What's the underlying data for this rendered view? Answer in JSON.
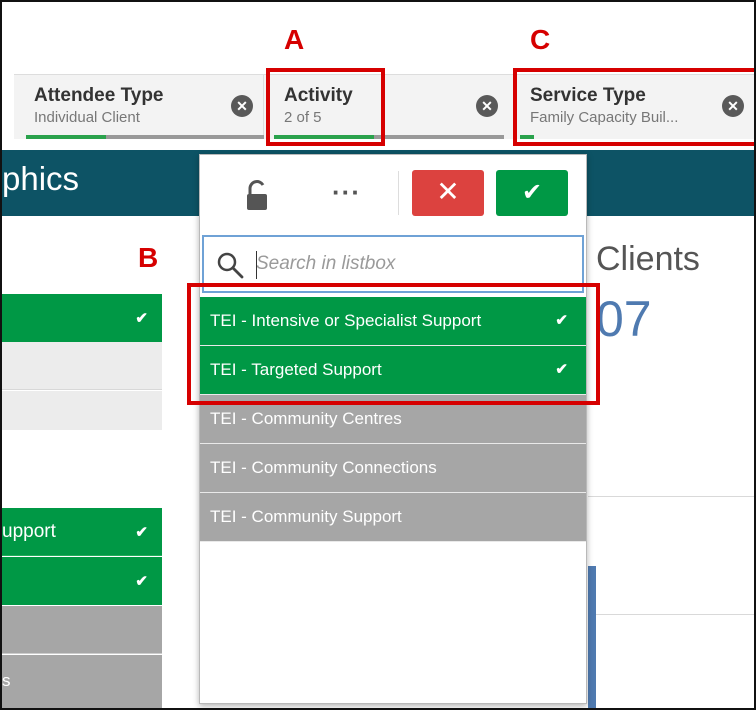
{
  "annotations": {
    "a": "A",
    "b": "B",
    "c": "C"
  },
  "selections": [
    {
      "title": "Attendee Type",
      "subtitle": "Individual Client"
    },
    {
      "title": "Activity",
      "subtitle": "2 of 5"
    },
    {
      "title": "Service Type",
      "subtitle": "Family Capacity Buil..."
    }
  ],
  "icons": {
    "clear": "clear-selection-icon",
    "lock": "unlock-icon",
    "more": "more-options-icon",
    "cancel": "close-icon",
    "confirm": "check-icon",
    "search": "search-icon",
    "check": "check-icon"
  },
  "sheet_title": "phics",
  "clear_glyph": "✕",
  "popup": {
    "more_glyph": "···",
    "cancel_glyph": "✕",
    "confirm_glyph": "✔",
    "search_placeholder": "Search in listbox",
    "items": [
      {
        "label": "TEI - Intensive or Specialist Support",
        "state": "selected",
        "check": "✔"
      },
      {
        "label": "TEI - Targeted Support",
        "state": "selected",
        "check": "✔"
      },
      {
        "label": "TEI - Community Centres",
        "state": "alternative",
        "check": ""
      },
      {
        "label": "TEI - Community Connections",
        "state": "alternative",
        "check": ""
      },
      {
        "label": "TEI - Community Support",
        "state": "alternative",
        "check": ""
      }
    ]
  },
  "left_panel": {
    "row1_check": "✔",
    "row4_text": "upport",
    "row4_check": "✔",
    "row5_check": "✔",
    "row7_text": "s"
  },
  "kpi": {
    "title": "Clients",
    "value": "07"
  },
  "colors": {
    "selected_green": "#009845",
    "teal_header": "#0d5365",
    "cancel_red": "#dc423f",
    "annotation_red": "#d60000",
    "kpi_blue": "#4f7ab0"
  }
}
